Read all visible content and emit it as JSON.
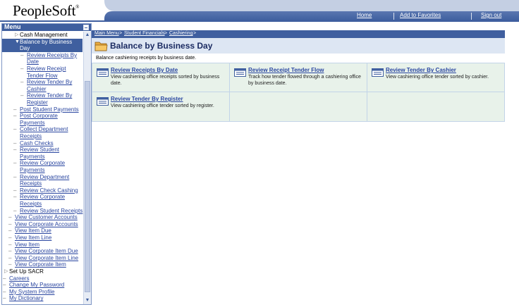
{
  "header": {
    "logo_text": "PeopleSoft",
    "logo_mark": "®",
    "nav": {
      "home": "Home",
      "favorites": "Add to Favorites",
      "signout": "Sign out"
    },
    "colors": {
      "nav_bg": "#3f5f9f",
      "band_bg": "#c4cfe3"
    }
  },
  "menu": {
    "title": "Menu",
    "items": [
      {
        "label": "Cash Management",
        "glyph": "▷",
        "link": false
      },
      {
        "label": "Balance by Business",
        "glyph": "▼",
        "link": false,
        "selected": true
      },
      {
        "label": "Day",
        "glyph": "",
        "link": false,
        "selected": true
      },
      {
        "label": "Review Receipts By",
        "glyph": "–",
        "link": true
      },
      {
        "label": "Date",
        "glyph": "",
        "link": true
      },
      {
        "label": "Review Receipt",
        "glyph": "–",
        "link": true
      },
      {
        "label": "Tender Flow",
        "glyph": "",
        "link": true
      },
      {
        "label": "Review Tender By",
        "glyph": "–",
        "link": true
      },
      {
        "label": "Cashier",
        "glyph": "",
        "link": true
      },
      {
        "label": "Review Tender By",
        "glyph": "–",
        "link": true
      },
      {
        "label": "Register",
        "glyph": "",
        "link": true
      },
      {
        "label": "Post Student Payments",
        "glyph": "–",
        "link": true
      },
      {
        "label": "Post Corporate",
        "glyph": "–",
        "link": true
      },
      {
        "label": "Payments",
        "glyph": "",
        "link": true
      },
      {
        "label": "Collect Department",
        "glyph": "–",
        "link": true
      },
      {
        "label": "Receipts",
        "glyph": "",
        "link": true
      },
      {
        "label": "Cash Checks",
        "glyph": "–",
        "link": true
      },
      {
        "label": "Review Student",
        "glyph": "–",
        "link": true
      },
      {
        "label": "Payments",
        "glyph": "",
        "link": true
      },
      {
        "label": "Review Corporate",
        "glyph": "–",
        "link": true
      },
      {
        "label": "Payments",
        "glyph": "",
        "link": true
      },
      {
        "label": "Review Department",
        "glyph": "–",
        "link": true
      },
      {
        "label": "Receipts",
        "glyph": "",
        "link": true
      },
      {
        "label": "Review Check Cashing",
        "glyph": "–",
        "link": true
      },
      {
        "label": "Review Corporate",
        "glyph": "–",
        "link": true
      },
      {
        "label": "Receipts",
        "glyph": "",
        "link": true
      },
      {
        "label": "Review Student Receipts",
        "glyph": "–",
        "link": true
      },
      {
        "label": "View Customer Accounts",
        "glyph": "–",
        "link": true
      },
      {
        "label": "View Corporate Accounts",
        "glyph": "–",
        "link": true
      },
      {
        "label": "View Item Due",
        "glyph": "–",
        "link": true
      },
      {
        "label": "View Item Line",
        "glyph": "–",
        "link": true
      },
      {
        "label": "View Item",
        "glyph": "–",
        "link": true
      },
      {
        "label": "View Corporate Item Due",
        "glyph": "–",
        "link": true
      },
      {
        "label": "View Corporate Item Line",
        "glyph": "–",
        "link": true
      },
      {
        "label": "View Corporate Item",
        "glyph": "–",
        "link": true
      },
      {
        "label": "Set Up SACR",
        "glyph": "▷",
        "link": false
      },
      {
        "label": "Careers",
        "glyph": "–",
        "link": true
      },
      {
        "label": "Change My Password",
        "glyph": "–",
        "link": true
      },
      {
        "label": "My System Profile",
        "glyph": "–",
        "link": true
      },
      {
        "label": "My Dictionary",
        "glyph": "–",
        "link": true
      }
    ]
  },
  "main": {
    "breadcrumb": {
      "main_menu": "Main Menu",
      "sep": ">",
      "student_financials": "Student Financials",
      "cashiering": "Cashiering"
    },
    "title": "Balance by Business Day",
    "description": "Balance cashiering receipts by business date.",
    "cards": [
      {
        "title": "Review Receipts By Date",
        "desc": "View cashiering office receipts sorted by business date."
      },
      {
        "title": "Review Receipt Tender Flow",
        "desc": "Track how tender flowed through a cashiering office by business date."
      },
      {
        "title": "Review Tender By Cashier",
        "desc": "View cashiering office tender sorted by cashier."
      },
      {
        "title": "Review Tender By Register",
        "desc": "View cashiering office tender sorted by register."
      }
    ]
  }
}
